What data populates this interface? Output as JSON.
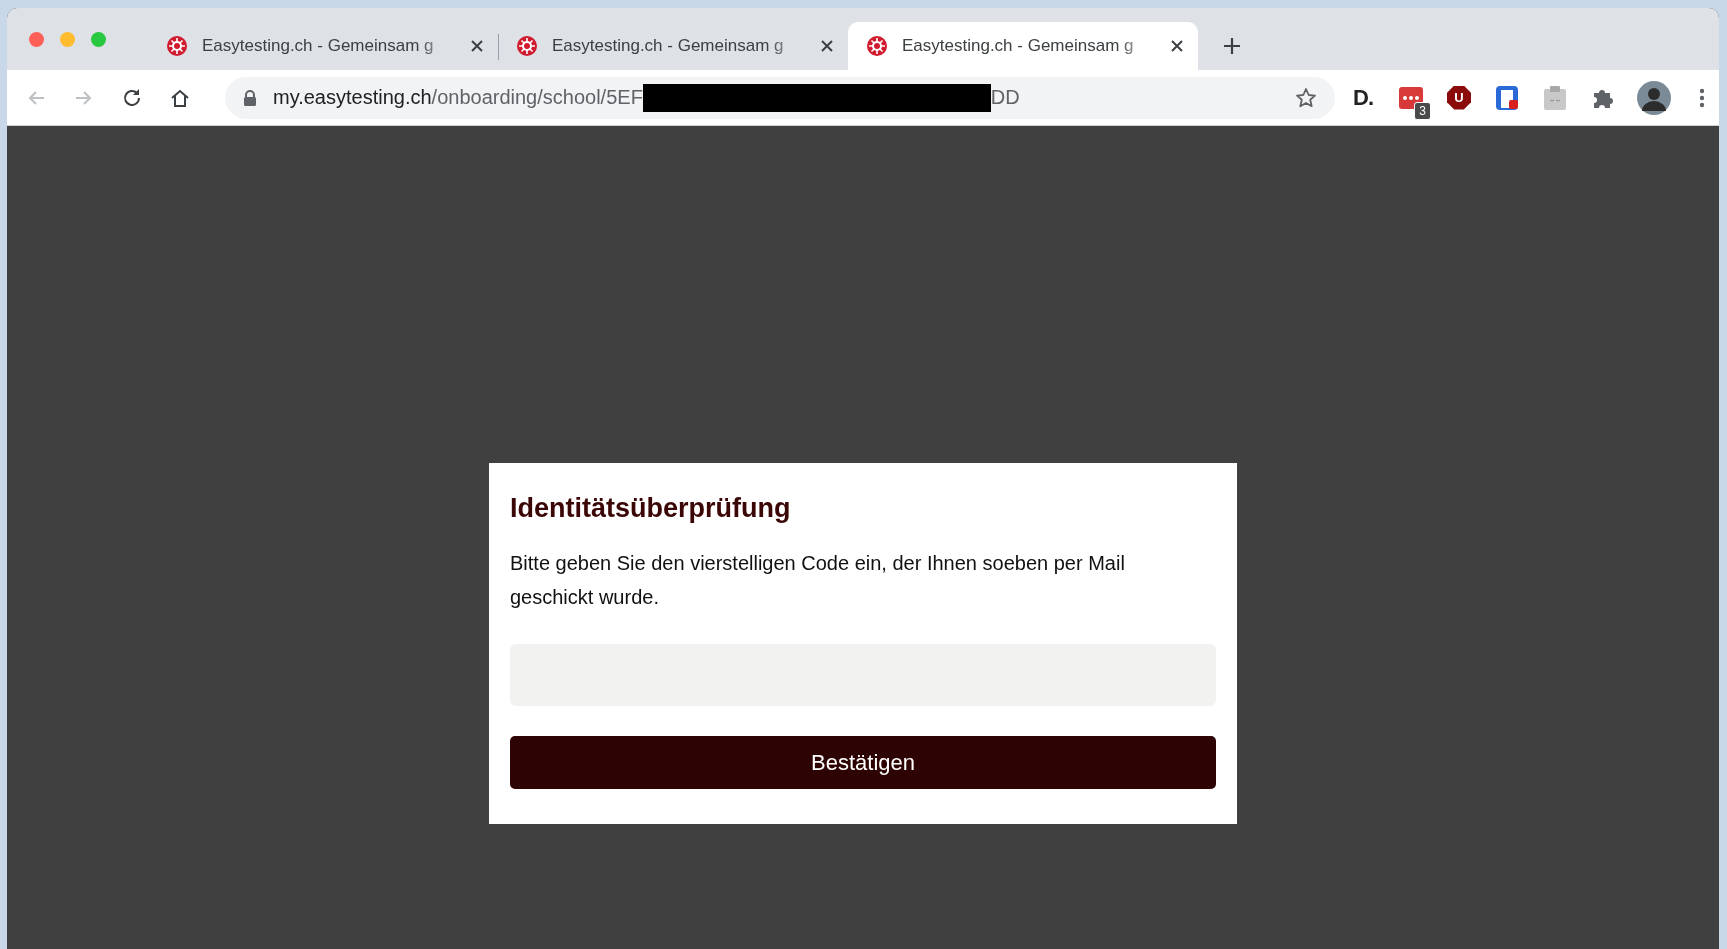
{
  "tabs": [
    {
      "title": "Easytesting.ch - Gemeinsam g",
      "selected": false
    },
    {
      "title": "Easytesting.ch - Gemeinsam g",
      "selected": false
    },
    {
      "title": "Easytesting.ch - Gemeinsam g",
      "selected": true
    }
  ],
  "nav": {
    "back_disabled": true,
    "forward_disabled": true
  },
  "address_bar": {
    "host": "my.easytesting.ch",
    "path": "/onboarding/school/5EF",
    "redacted": true,
    "path_end": "DD"
  },
  "extensions": [
    {
      "kind": "letter-logo",
      "text": "D."
    },
    {
      "kind": "badged",
      "badge": "3"
    },
    {
      "kind": "octagon",
      "text": "U"
    },
    {
      "kind": "bookmark"
    },
    {
      "kind": "clipboard"
    },
    {
      "kind": "puzzle"
    },
    {
      "kind": "avatar"
    }
  ],
  "dialog": {
    "title": "Identitätsüberprüfung",
    "message": "Bitte geben Sie den vierstelligen Code ein, der Ihnen soeben per Mail geschickt wurde.",
    "button": "Bestätigen"
  }
}
